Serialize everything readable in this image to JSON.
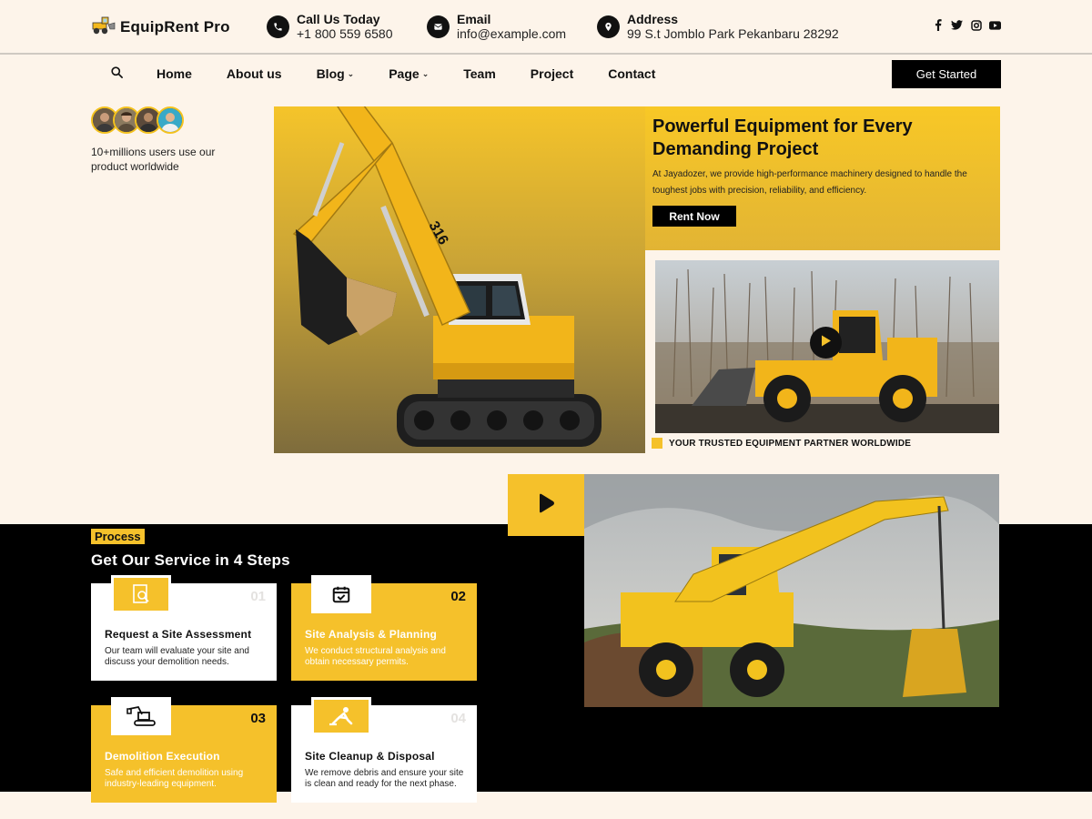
{
  "brand": {
    "name": "EquipRent Pro",
    "logo_icon": "loader-truck-icon"
  },
  "contacts": [
    {
      "label": "Call Us Today",
      "value": "+1 800 559 6580",
      "icon": "phone-icon"
    },
    {
      "label": "Email",
      "value": "info@example.com",
      "icon": "mail-icon"
    },
    {
      "label": "Address",
      "value": "99 S.t Jomblo Park Pekanbaru 28292",
      "icon": "location-pin-icon"
    }
  ],
  "socials": [
    "facebook-icon",
    "twitter-icon",
    "instagram-icon",
    "youtube-icon"
  ],
  "nav": {
    "items": [
      {
        "label": "Home",
        "dropdown": false
      },
      {
        "label": "About us",
        "dropdown": false
      },
      {
        "label": "Blog",
        "dropdown": true
      },
      {
        "label": "Page",
        "dropdown": true
      },
      {
        "label": "Team",
        "dropdown": false
      },
      {
        "label": "Project",
        "dropdown": false
      },
      {
        "label": "Contact",
        "dropdown": false
      }
    ],
    "cta": "Get Started"
  },
  "users": {
    "text": "10+millions users use our product worldwide"
  },
  "hero": {
    "title": "Powerful Equipment for Every Demanding Project",
    "description": "At Jayadozer, we provide high-performance machinery designed to handle the toughest jobs with precision, reliability, and efficiency.",
    "button": "Rent Now",
    "partner_text": "YOUR TRUSTED EQUIPMENT PARTNER WORLDWIDE"
  },
  "process": {
    "tag": "Process",
    "title": "Get Our Service in 4 Steps",
    "steps": [
      {
        "num": "01",
        "title": "Request a Site Assessment",
        "desc": "Our team will evaluate your site and discuss your demolition needs.",
        "icon": "search-document-icon",
        "style": "white"
      },
      {
        "num": "02",
        "title": "Site Analysis & Planning",
        "desc": "We conduct structural analysis and obtain necessary permits.",
        "icon": "calendar-check-icon",
        "style": "yellow"
      },
      {
        "num": "03",
        "title": "Demolition Execution",
        "desc": "Safe and efficient demolition using industry-leading equipment.",
        "icon": "excavator-icon",
        "style": "yellow"
      },
      {
        "num": "04",
        "title": "Site Cleanup & Disposal",
        "desc": "We remove debris and ensure your site is clean and ready for the next phase.",
        "icon": "worker-cleanup-icon",
        "style": "white"
      }
    ]
  },
  "colors": {
    "accent": "#f5c12b",
    "dark": "#000000",
    "background": "#fdf4ea"
  }
}
